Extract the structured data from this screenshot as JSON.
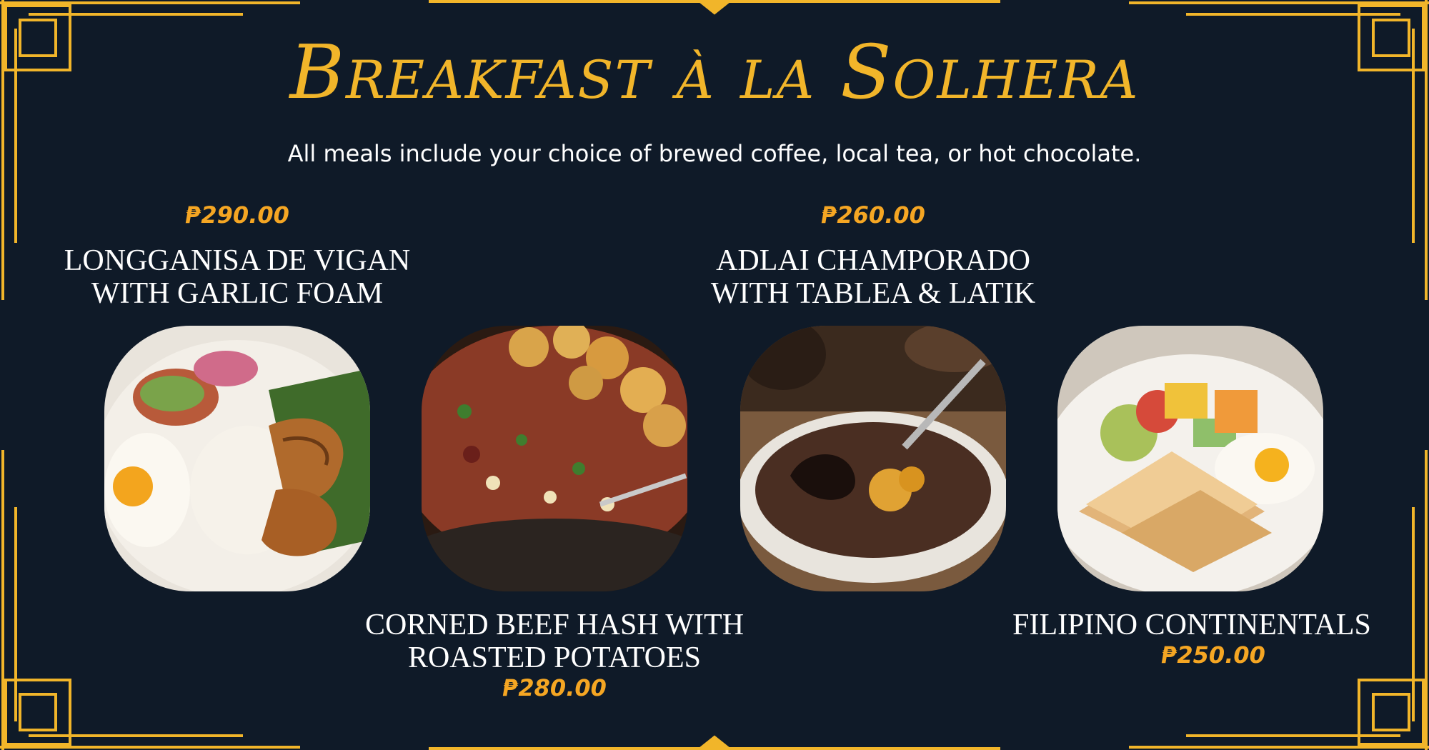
{
  "menu": {
    "title": "Breakfast à la Solhera",
    "subtitle": "All meals include your choice of brewed coffee, local tea, or hot chocolate."
  },
  "items": [
    {
      "name_line1": "LONGGANISA DE VIGAN",
      "name_line2": "WITH GARLIC FOAM",
      "price": "₱290.00"
    },
    {
      "name_line1": "CORNED BEEF HASH WITH",
      "name_line2": "ROASTED POTATOES",
      "price": "₱280.00"
    },
    {
      "name_line1": "ADLAI CHAMPORADO",
      "name_line2": "WITH TABLEA & LATIK",
      "price": "₱260.00"
    },
    {
      "name_line1": "FILIPINO CONTINENTALS",
      "price": "₱250.00"
    }
  ],
  "colors": {
    "background": "#0f1a28",
    "gold": "#f1b52a",
    "price": "#f5a623",
    "text": "#ffffff"
  }
}
